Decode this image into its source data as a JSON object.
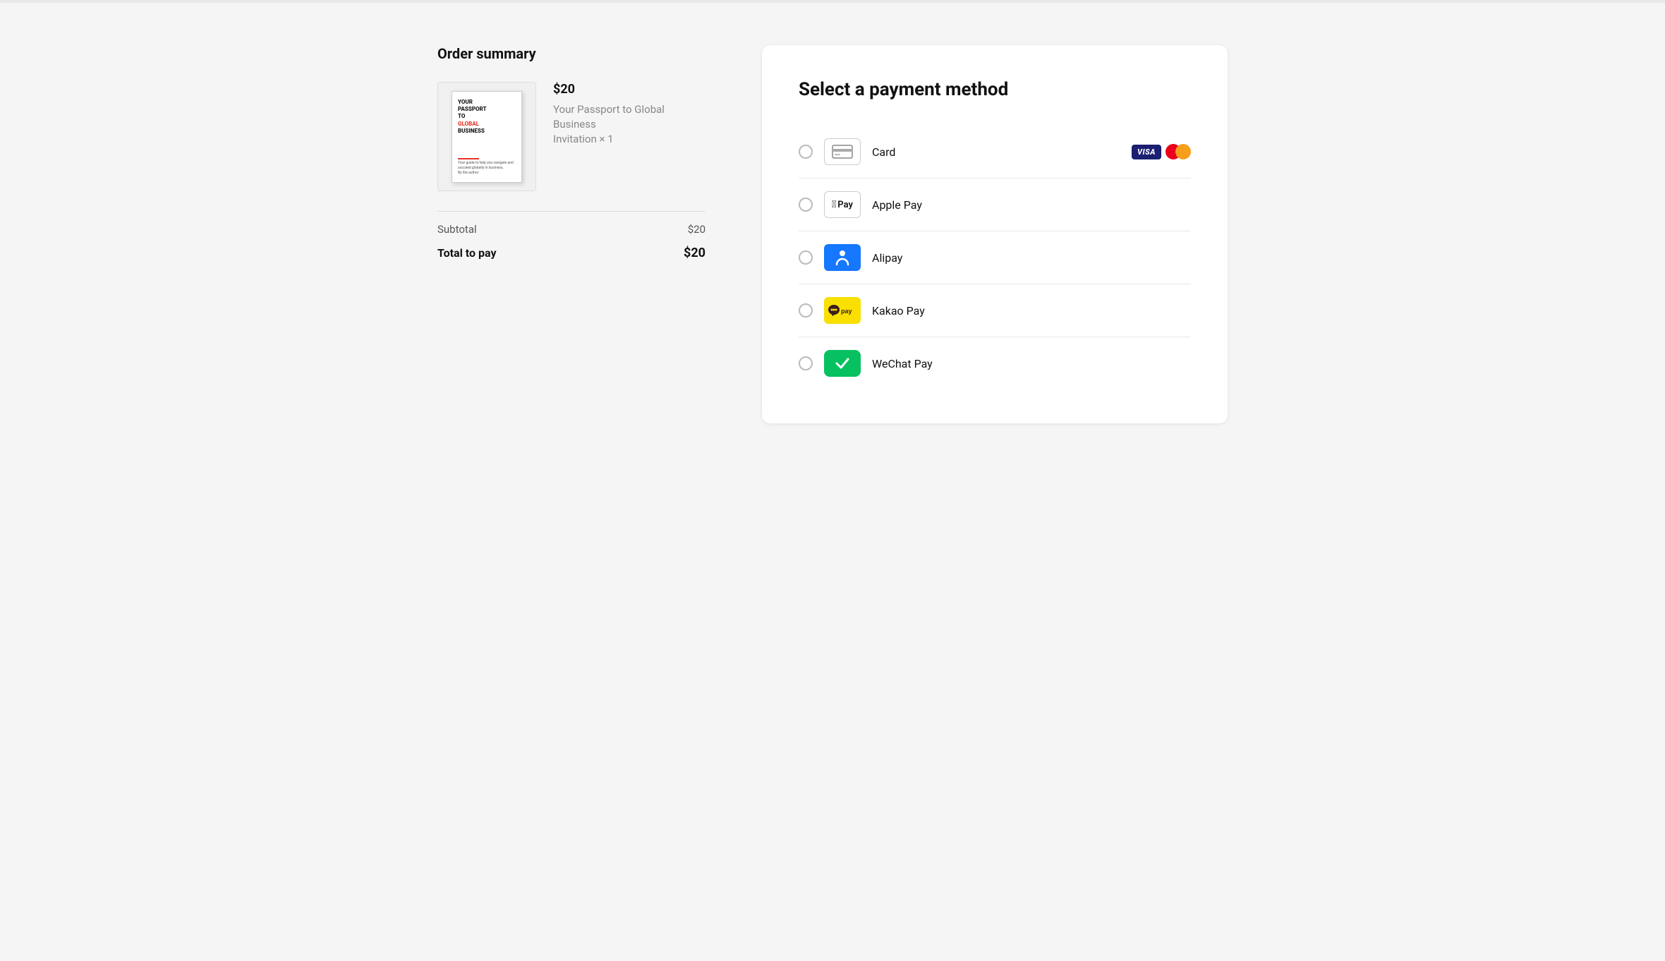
{
  "topbar": {},
  "order_summary": {
    "title": "Order summary",
    "product": {
      "image_text_line1": "YOUR",
      "image_text_line2": "PASSPORT",
      "image_text_line3": "TO",
      "image_text_line4": "GLOBAL",
      "image_text_line5": "BUSINESS",
      "price": "$20",
      "name": "Your Passport to Global Business",
      "quantity_label": "Invitation × 1"
    },
    "subtotal_label": "Subtotal",
    "subtotal_value": "$20",
    "total_label": "Total to pay",
    "total_value": "$20"
  },
  "payment": {
    "title": "Select a payment method",
    "options": [
      {
        "id": "card",
        "label": "Card",
        "icon_type": "card",
        "has_badges": true
      },
      {
        "id": "applepay",
        "label": "Apple Pay",
        "icon_type": "applepay",
        "has_badges": false
      },
      {
        "id": "alipay",
        "label": "Alipay",
        "icon_type": "alipay",
        "has_badges": false
      },
      {
        "id": "kakaopay",
        "label": "Kakao Pay",
        "icon_type": "kakaopay",
        "has_badges": false
      },
      {
        "id": "wechat",
        "label": "WeChat Pay",
        "icon_type": "wechat",
        "has_badges": false
      }
    ],
    "visa_label": "VISA",
    "mastercard_label": "MC"
  }
}
